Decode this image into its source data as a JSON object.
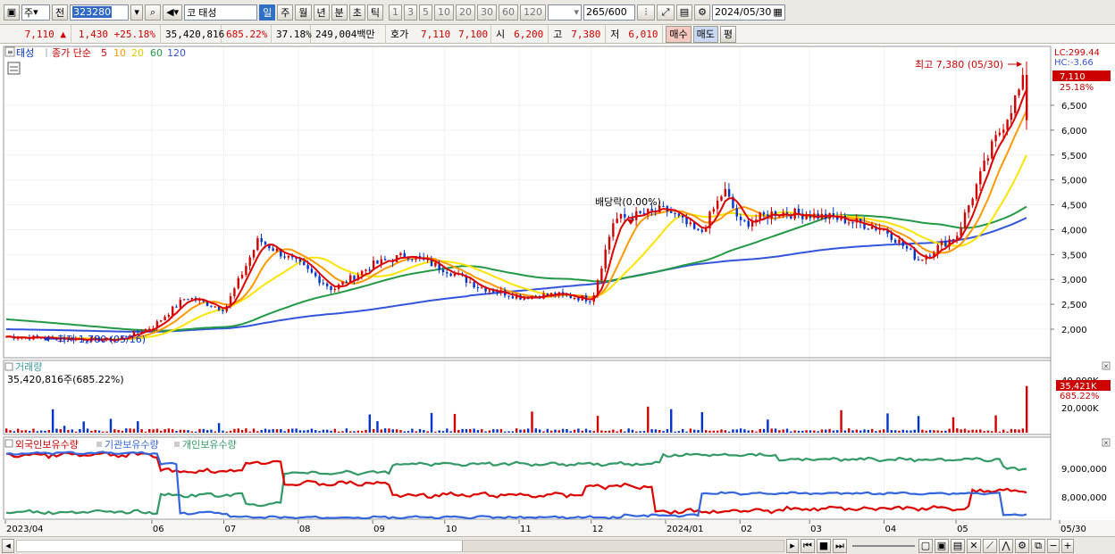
{
  "toolbar": {
    "market": "주",
    "prev_label": "전",
    "code": "323280",
    "stock_name": "태성",
    "kor_label": "코",
    "periods": [
      "일",
      "주",
      "월",
      "년",
      "분",
      "초",
      "틱"
    ],
    "selected_period": "일",
    "intervals": [
      "1",
      "3",
      "5",
      "10",
      "20",
      "30",
      "60",
      "120"
    ],
    "count": "265",
    "count_total": "/600",
    "date": "2024/05/30"
  },
  "quote": {
    "price": "7,110",
    "arrow": "▲",
    "change": "1,430",
    "change_pct": "+25.18%",
    "volume": "35,420,816",
    "volume_ratio": "685.22%",
    "turnover": "37.18%",
    "amount": "249,004백만",
    "hoga_label": "호가",
    "ask": "7,110",
    "bid": "7,100",
    "open_label": "시",
    "open": "6,200",
    "high_label": "고",
    "high": "7,380",
    "low_label": "저",
    "low": "6,010",
    "buy_label": "매수",
    "sell_label": "매도",
    "avg_label": "평"
  },
  "price_panel": {
    "title": "태성",
    "ma_label": "종가 단순",
    "ma_periods": [
      "5",
      "10",
      "20",
      "60",
      "120"
    ],
    "lc": "LC:299.44",
    "hc": "HC:-3.66",
    "last_price": "7,110",
    "last_pct": "25.18%",
    "high_note": "최고 7,380 (05/30)",
    "low_note": "최저 1,780 (05/16)",
    "dividend_note": "배당락(0.00%)",
    "y_ticks": [
      "6,500",
      "6,000",
      "5,500",
      "5,000",
      "4,500",
      "4,000",
      "3,500",
      "3,000",
      "2,500",
      "2,000"
    ]
  },
  "volume_panel": {
    "title": "거래량",
    "summary": "35,420,816주(685.22%)",
    "last_value": "35,421K",
    "last_pct": "685.22%",
    "y_ticks": [
      "40,000K",
      "20,000K"
    ]
  },
  "holding_panel": {
    "foreign": "외국인보유수량",
    "institution": "기관보유수량",
    "individual": "개인보유수량",
    "y_ticks": [
      "9,000,000",
      "8,000,000"
    ]
  },
  "x_axis": [
    "2023/04",
    "06",
    "07",
    "08",
    "09",
    "10",
    "11",
    "12",
    "2024/01",
    "02",
    "03",
    "04",
    "05",
    "05/30"
  ],
  "colors": {
    "up": "#d00000",
    "down": "#0033cc",
    "ma5": "#dd0000",
    "ma10": "#ff9900",
    "ma20": "#ffe400",
    "ma60": "#229944",
    "ma120": "#3355dd",
    "foreign": "#dd0000",
    "institution": "#3366dd",
    "individual": "#339966"
  },
  "chart_data": {
    "type": "candlestick",
    "x_range": [
      "2023/04",
      "2024/05/30"
    ],
    "y_range": [
      1780,
      7380
    ],
    "close_series_approx": [
      {
        "date": "2023/04",
        "value": 1850
      },
      {
        "date": "2023/05/16",
        "value": 1780
      },
      {
        "date": "2023/06",
        "value": 2050
      },
      {
        "date": "2023/06/15",
        "value": 2650
      },
      {
        "date": "2023/07",
        "value": 2400
      },
      {
        "date": "2023/07/15",
        "value": 3800
      },
      {
        "date": "2023/08",
        "value": 3300
      },
      {
        "date": "2023/08/15",
        "value": 2800
      },
      {
        "date": "2023/09",
        "value": 3300
      },
      {
        "date": "2023/09/15",
        "value": 3500
      },
      {
        "date": "2023/10",
        "value": 3200
      },
      {
        "date": "2023/10/15",
        "value": 2850
      },
      {
        "date": "2023/11",
        "value": 2650
      },
      {
        "date": "2023/11/15",
        "value": 2700
      },
      {
        "date": "2023/12",
        "value": 2600
      },
      {
        "date": "2023/12/10",
        "value": 4200
      },
      {
        "date": "2024/01",
        "value": 4400
      },
      {
        "date": "2024/01/15",
        "value": 3900
      },
      {
        "date": "2024/01/25",
        "value": 4800
      },
      {
        "date": "2024/02",
        "value": 4100
      },
      {
        "date": "2024/02/15",
        "value": 4350
      },
      {
        "date": "2024/03",
        "value": 4300
      },
      {
        "date": "2024/03/15",
        "value": 4200
      },
      {
        "date": "2024/04",
        "value": 4000
      },
      {
        "date": "2024/04/15",
        "value": 3400
      },
      {
        "date": "2024/05",
        "value": 3900
      },
      {
        "date": "2024/05/15",
        "value": 5600
      },
      {
        "date": "2024/05/30",
        "value": 7110
      }
    ]
  }
}
